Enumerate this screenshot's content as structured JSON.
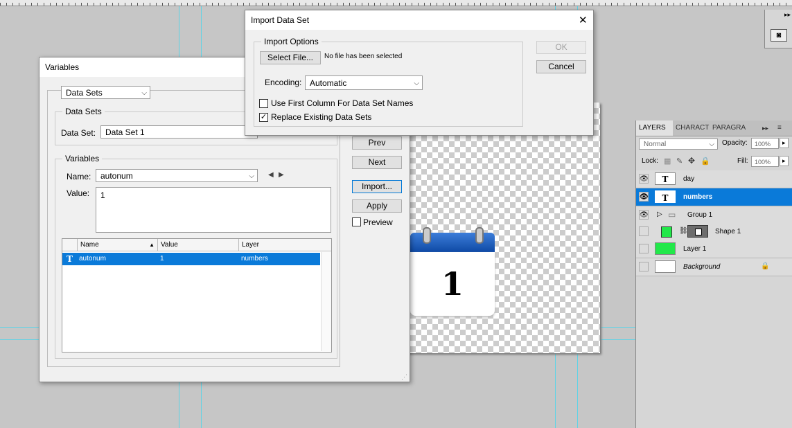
{
  "import_dialog": {
    "title": "Import Data Set",
    "close_glyph": "✕",
    "options_label": "Import Options",
    "select_file_label": "Select File...",
    "file_status": "No file has been selected",
    "encoding_label": "Encoding:",
    "encoding_value": "Automatic",
    "use_first_column_label": "Use First Column For Data Set Names",
    "use_first_column_checked": false,
    "replace_existing_label": "Replace Existing Data Sets",
    "replace_existing_checked": true,
    "ok_label": "OK",
    "cancel_label": "Cancel"
  },
  "variables_dialog": {
    "title": "Variables",
    "view_select": "Data Sets",
    "datasets_group_label": "Data Sets",
    "dataset_label": "Data Set:",
    "dataset_value": "Data Set 1",
    "variables_group_label": "Variables",
    "name_label": "Name:",
    "name_value": "autonum",
    "value_label": "Value:",
    "value_text": "1",
    "buttons": {
      "prev": "Prev",
      "next": "Next",
      "import": "Import...",
      "apply": "Apply"
    },
    "preview_label": "Preview",
    "table": {
      "columns": [
        "Name",
        "Value",
        "Layer"
      ],
      "rows": [
        {
          "type_icon": "T",
          "name": "autonum",
          "value": "1",
          "layer": "numbers"
        }
      ]
    }
  },
  "canvas": {
    "calendar_number": "1"
  },
  "layers_panel": {
    "tabs": [
      "LAYERS",
      "CHARACT",
      "PARAGRA"
    ],
    "blend_mode": "Normal",
    "opacity_label": "Opacity:",
    "opacity_value": "100%",
    "lock_label": "Lock:",
    "fill_label": "Fill:",
    "fill_value": "100%",
    "layers": [
      {
        "name": "day",
        "thumb": "T",
        "visible": true,
        "selected": false
      },
      {
        "name": "numbers",
        "thumb": "T",
        "visible": true,
        "selected": true
      },
      {
        "name": "Group 1",
        "thumb": "",
        "visible": true,
        "selected": false
      },
      {
        "name": "Shape 1",
        "thumb": "",
        "visible": false,
        "selected": false
      },
      {
        "name": "Layer 1",
        "thumb": "",
        "visible": false,
        "selected": false
      },
      {
        "name": "Background",
        "thumb": "",
        "visible": false,
        "selected": false
      }
    ]
  },
  "colors": {
    "selection": "#0a7ad9",
    "guide": "#5ed3e6",
    "shape_green": "#22e84a"
  }
}
